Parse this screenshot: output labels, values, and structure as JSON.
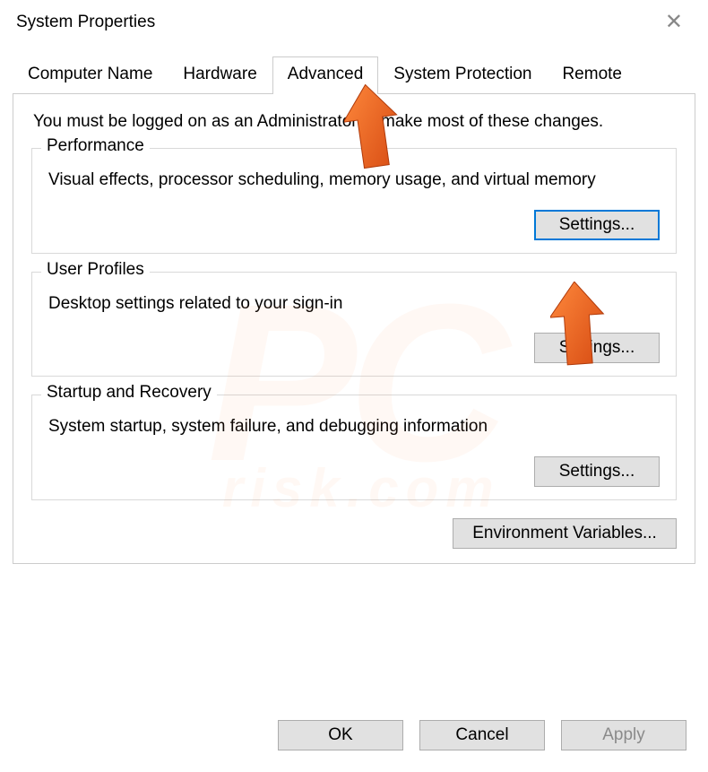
{
  "window": {
    "title": "System Properties"
  },
  "tabs": {
    "computer_name": "Computer Name",
    "hardware": "Hardware",
    "advanced": "Advanced",
    "system_protection": "System Protection",
    "remote": "Remote"
  },
  "advanced": {
    "admin_msg": "You must be logged on as an Administrator to make most of these changes.",
    "performance": {
      "legend": "Performance",
      "desc": "Visual effects, processor scheduling, memory usage, and virtual memory",
      "button": "Settings..."
    },
    "user_profiles": {
      "legend": "User Profiles",
      "desc": "Desktop settings related to your sign-in",
      "button": "Settings..."
    },
    "startup": {
      "legend": "Startup and Recovery",
      "desc": "System startup, system failure, and debugging information",
      "button": "Settings..."
    },
    "env_button": "Environment Variables..."
  },
  "buttons": {
    "ok": "OK",
    "cancel": "Cancel",
    "apply": "Apply"
  },
  "watermark": {
    "main": "PC",
    "sub": "risk.com"
  }
}
